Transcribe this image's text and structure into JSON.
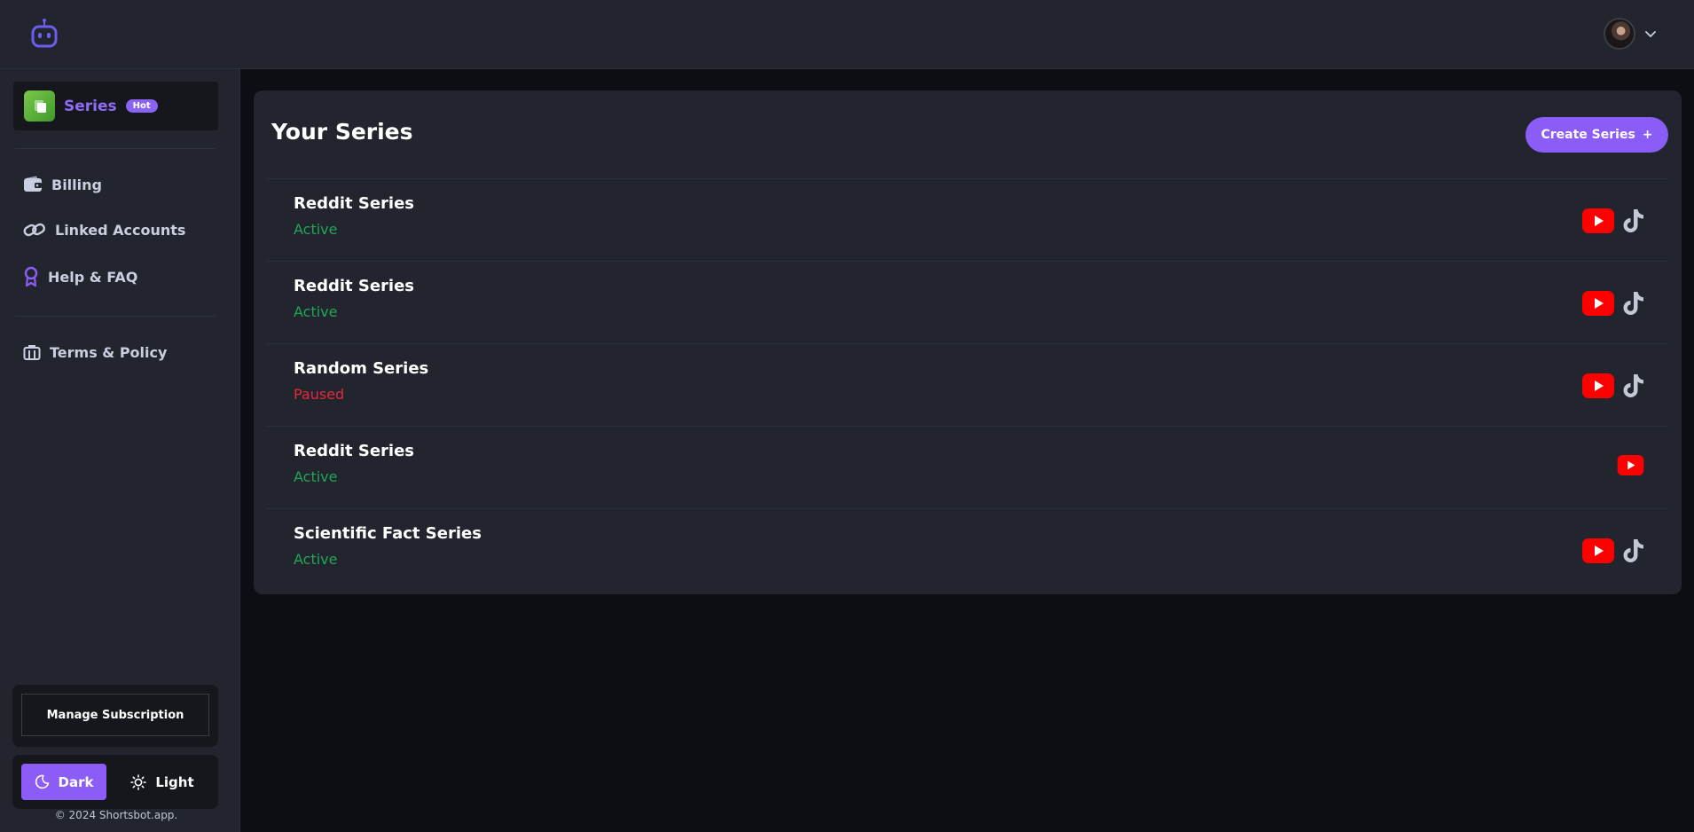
{
  "app": {
    "logo_icon": "robot-icon",
    "accent": "#8b5cf6"
  },
  "header": {
    "avatar_icon": "user-avatar",
    "menu_icon": "chevron-down-icon"
  },
  "sidebar": {
    "series": {
      "label": "Series",
      "badge": "Hot"
    },
    "items": [
      {
        "label": "Billing",
        "icon": "wallet-icon"
      },
      {
        "label": "Linked Accounts",
        "icon": "link-icon"
      },
      {
        "label": "Help & FAQ",
        "icon": "award-icon"
      },
      {
        "label": "Terms & Policy",
        "icon": "briefcase-icon"
      }
    ],
    "manage_label": "Manage Subscription",
    "theme": {
      "dark_label": "Dark",
      "light_label": "Light",
      "selected": "Dark"
    },
    "copyright": "© 2024 Shortsbot.app."
  },
  "main": {
    "title": "Your Series",
    "create_label": "Create Series",
    "create_icon": "+",
    "series": [
      {
        "name": "Reddit Series",
        "status": "Active",
        "platforms": [
          "youtube",
          "tiktok"
        ]
      },
      {
        "name": "Reddit Series",
        "status": "Active",
        "platforms": [
          "youtube",
          "tiktok"
        ]
      },
      {
        "name": "Random Series",
        "status": "Paused",
        "platforms": [
          "youtube",
          "tiktok"
        ]
      },
      {
        "name": "Reddit Series",
        "status": "Active",
        "platforms": [
          "youtube"
        ]
      },
      {
        "name": "Scientific Fact Series",
        "status": "Active",
        "platforms": [
          "youtube",
          "tiktok"
        ]
      }
    ],
    "status_colors": {
      "Active": "#22a55a",
      "Paused": "#e5283e"
    }
  }
}
